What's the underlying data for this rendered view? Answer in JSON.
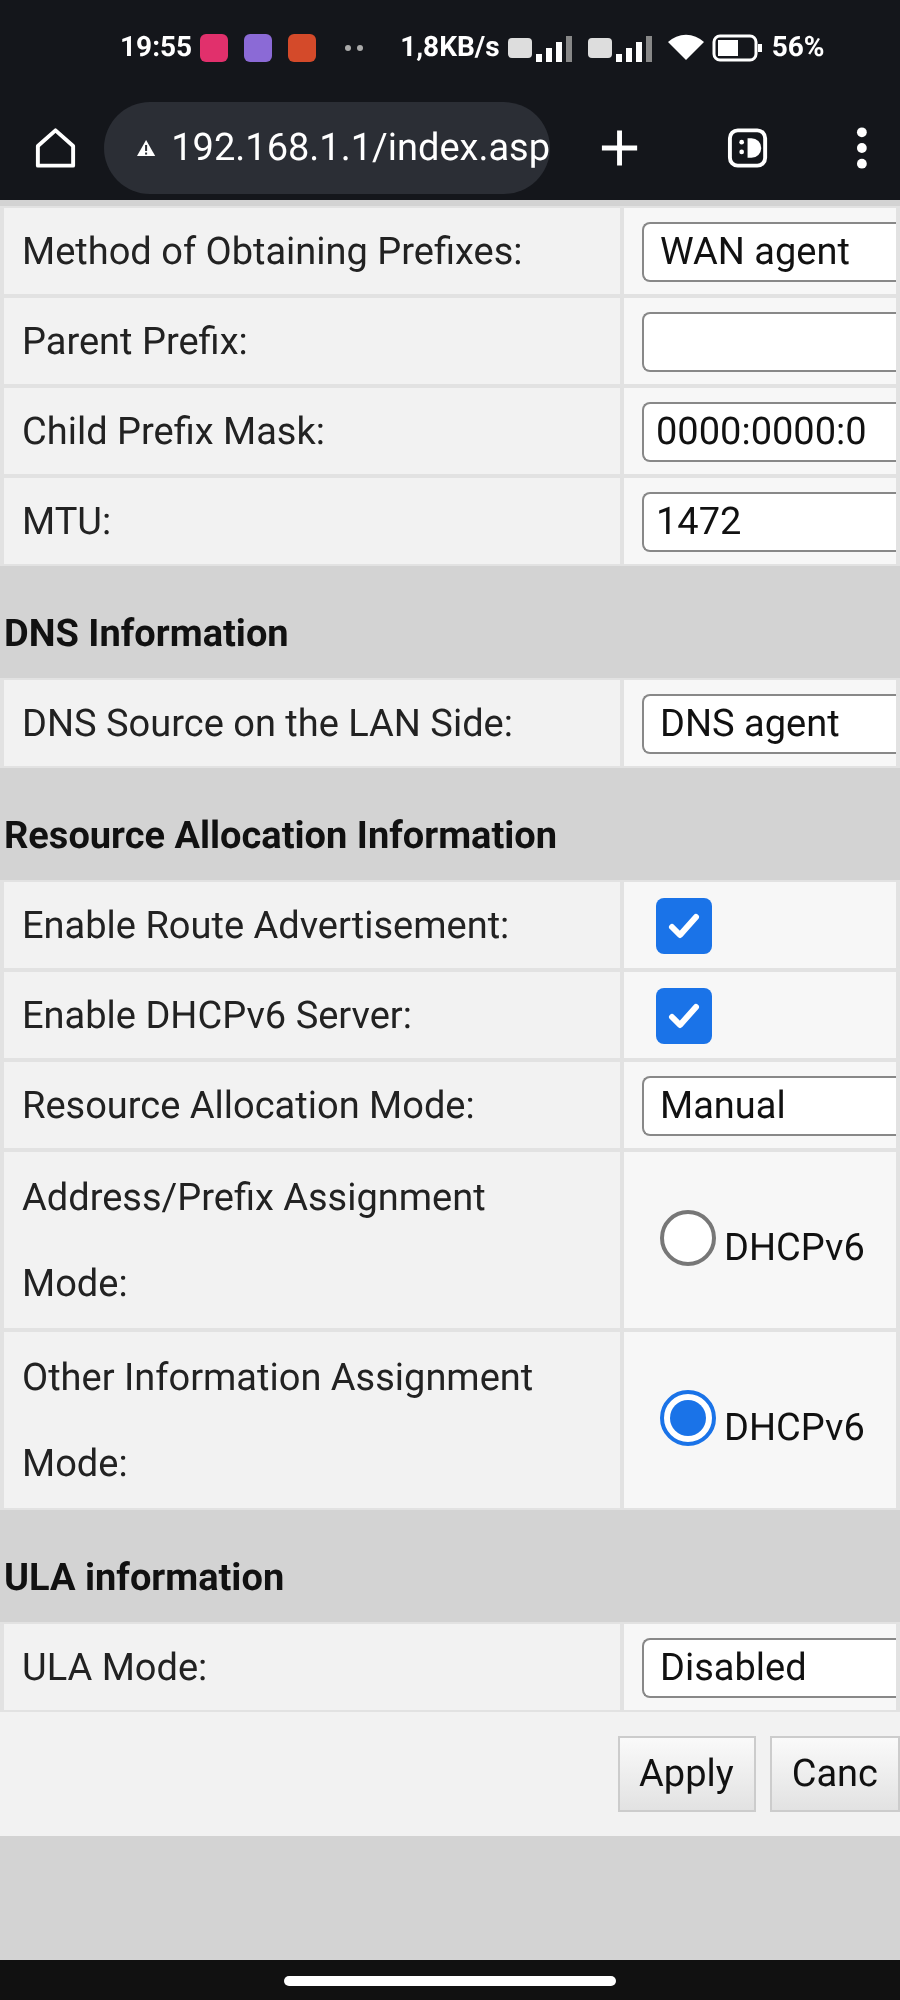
{
  "status_bar": {
    "time": "19:55",
    "net_speed": "1,8KB/s",
    "battery": "56%"
  },
  "browser": {
    "url": "192.168.1.1/index.asp"
  },
  "sections": [
    {
      "rows": [
        {
          "label": "Method of Obtaining Prefixes:",
          "kind": "select",
          "value": "WAN agent"
        },
        {
          "label": "Parent Prefix:",
          "kind": "input"
        },
        {
          "label": "Child Prefix Mask:",
          "kind": "input",
          "value": "0000:0000:0"
        },
        {
          "label": "MTU:",
          "kind": "input",
          "value": "1472"
        }
      ]
    },
    {
      "title": "DNS Information",
      "rows": [
        {
          "label": "DNS Source on the LAN Side:",
          "kind": "select",
          "value": "DNS agent"
        }
      ]
    },
    {
      "title": "Resource Allocation Information",
      "rows": [
        {
          "label": "Enable Route Advertisement:",
          "kind": "checkbox",
          "checked": true
        },
        {
          "label": "Enable DHCPv6 Server:",
          "kind": "checkbox",
          "checked": true
        },
        {
          "label": "Resource Allocation Mode:",
          "kind": "select",
          "value": "Manual"
        },
        {
          "label": "Address/Prefix Assignment Mode:",
          "kind": "radio",
          "value": "DHCPv6",
          "selected": false
        },
        {
          "label": "Other Information Assignment Mode:",
          "kind": "radio",
          "value": "DHCPv6",
          "selected": true
        }
      ]
    },
    {
      "title": "ULA information",
      "rows": [
        {
          "label": "ULA Mode:",
          "kind": "select",
          "value": "Disabled"
        }
      ]
    }
  ],
  "buttons": [
    "Apply",
    "Canc"
  ]
}
